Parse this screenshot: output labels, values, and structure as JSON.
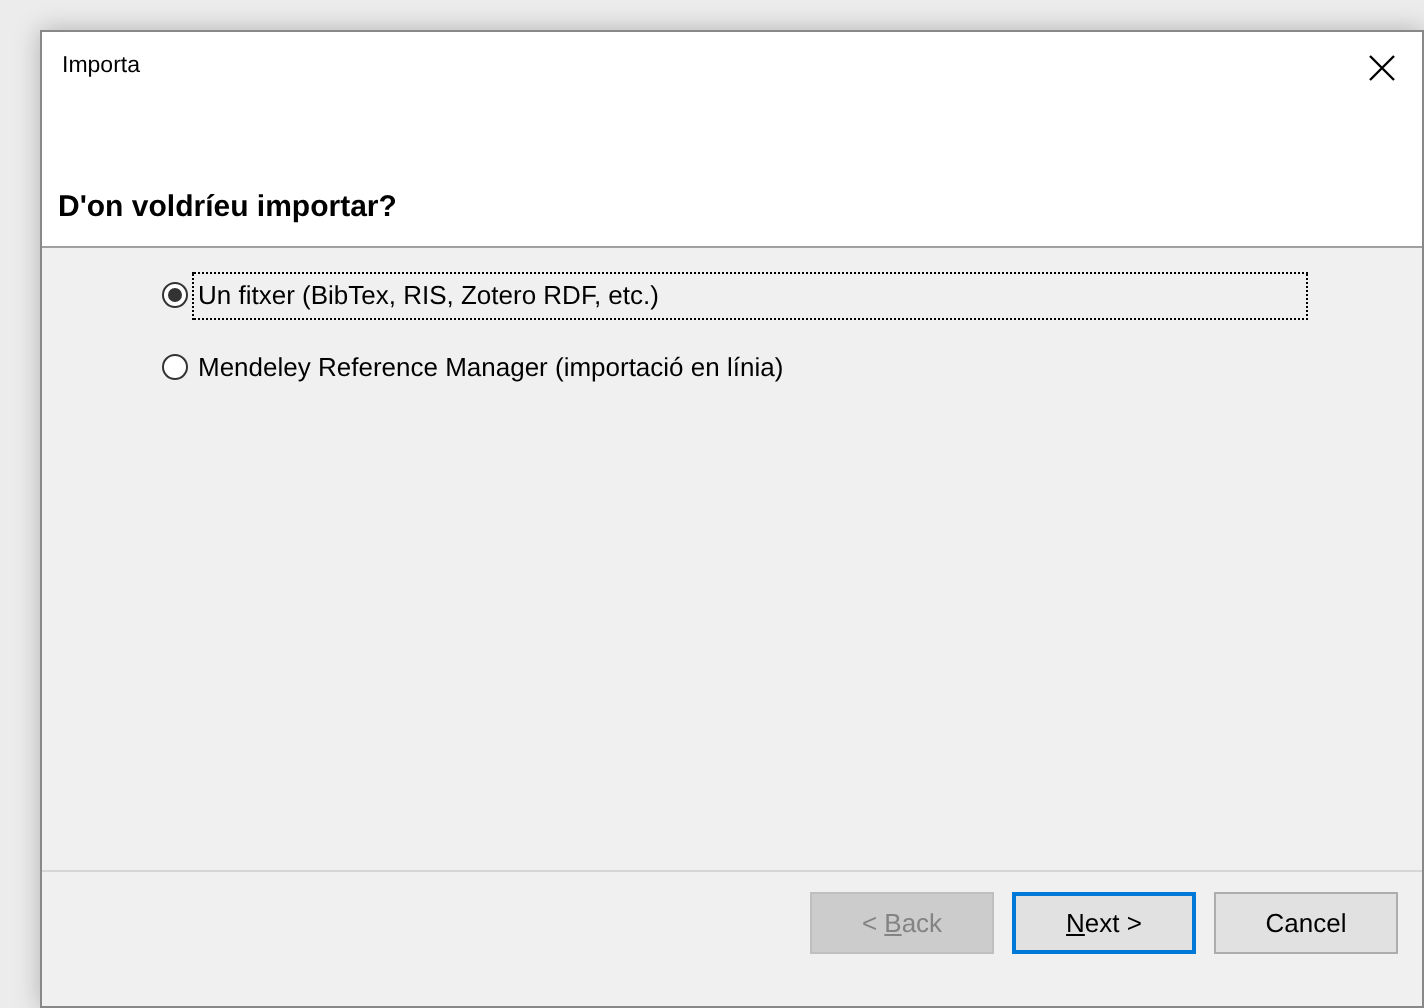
{
  "window": {
    "title": "Importa"
  },
  "heading": "D'on voldríeu importar?",
  "options": [
    {
      "label": "Un fitxer (BibTex, RIS, Zotero RDF, etc.)",
      "selected": true,
      "focused": true
    },
    {
      "label": "Mendeley Reference Manager (importació en línia)",
      "selected": false,
      "focused": false
    }
  ],
  "buttons": [
    {
      "label_parts": [
        {
          "text": "< ",
          "underlined": false
        },
        {
          "text": "B",
          "underlined": true
        },
        {
          "text": "ack",
          "underlined": false
        }
      ],
      "disabled": true,
      "default": false
    },
    {
      "label_parts": [
        {
          "text": "N",
          "underlined": true
        },
        {
          "text": "ext >",
          "underlined": false
        }
      ],
      "disabled": false,
      "default": true
    },
    {
      "label_parts": [
        {
          "text": "Cancel",
          "underlined": false
        }
      ],
      "disabled": false,
      "default": false
    }
  ]
}
